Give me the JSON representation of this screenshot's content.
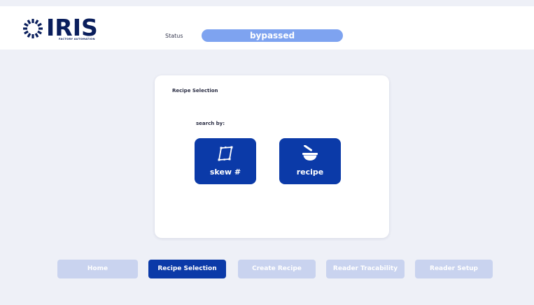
{
  "header": {
    "logo_text": "IRIS",
    "logo_subtitle": "FACTORY AUTOMATION",
    "status_label": "Status",
    "status_value": "bypassed",
    "status_color": "#7ea3f0"
  },
  "card": {
    "title": "Recipe Selection",
    "search_by_label": "search by:",
    "options": [
      {
        "label": "skew #",
        "icon": "skew-crop-icon"
      },
      {
        "label": "recipe",
        "icon": "mortar-pestle-icon"
      }
    ]
  },
  "nav": {
    "items": [
      {
        "label": "Home",
        "active": false
      },
      {
        "label": "Recipe Selection",
        "active": true
      },
      {
        "label": "Create Recipe",
        "active": false
      },
      {
        "label": "Reader Tracability",
        "active": false
      },
      {
        "label": "Reader Setup",
        "active": false
      }
    ],
    "active_color": "#0b3aa8",
    "inactive_color": "#c9d3ef"
  }
}
